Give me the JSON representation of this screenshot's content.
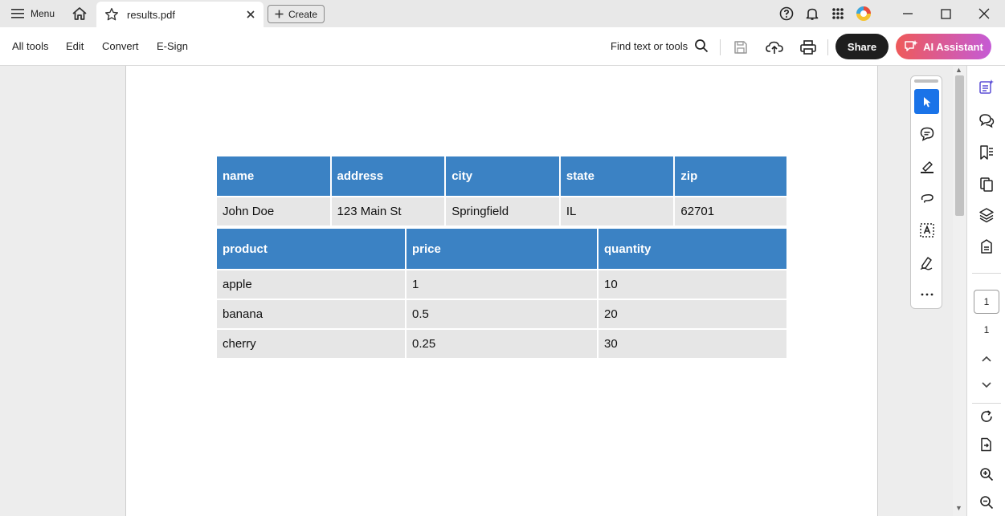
{
  "titlebar": {
    "menu_label": "Menu",
    "tab_title": "results.pdf",
    "create_label": "Create"
  },
  "toolbar": {
    "nav": [
      "All tools",
      "Edit",
      "Convert",
      "E-Sign"
    ],
    "find_label": "Find text or tools",
    "share_label": "Share",
    "ai_label": "AI Assistant"
  },
  "colors": {
    "table_header": "#3b82c4",
    "table_cell": "#e6e6e6",
    "ai_gradient_start": "#ee5a5a",
    "ai_gradient_end": "#c55bd6",
    "active_tool": "#1a73e8"
  },
  "document": {
    "table1": {
      "headers": [
        "name",
        "address",
        "city",
        "state",
        "zip"
      ],
      "rows": [
        [
          "John Doe",
          "123 Main St",
          "Springfield",
          "IL",
          "62701"
        ]
      ]
    },
    "table2": {
      "headers": [
        "product",
        "price",
        "quantity"
      ],
      "rows": [
        [
          "apple",
          "1",
          "10"
        ],
        [
          "banana",
          "0.5",
          "20"
        ],
        [
          "cherry",
          "0.25",
          "30"
        ]
      ]
    }
  },
  "rail": {
    "current_page": "1",
    "total_pages": "1"
  }
}
